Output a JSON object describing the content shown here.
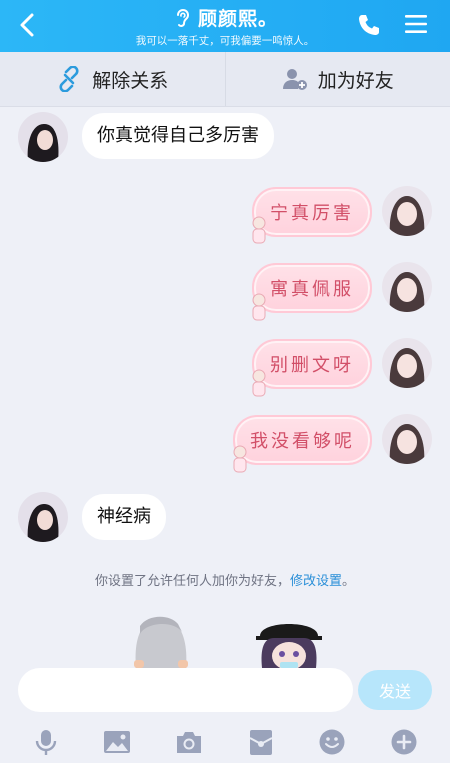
{
  "header": {
    "title": "顾颜熙。",
    "subtitle": "我可以一落千丈，可我偏要一鸣惊人。"
  },
  "actions": {
    "remove_relation": "解除关系",
    "add_friend": "加为好友"
  },
  "messages": [
    {
      "side": "in",
      "text": "你真觉得自己多厉害"
    },
    {
      "side": "out",
      "text": "宁真厉害"
    },
    {
      "side": "out",
      "text": "寓真佩服"
    },
    {
      "side": "out",
      "text": "别删文呀"
    },
    {
      "side": "out",
      "text": "我没看够呢"
    },
    {
      "side": "in",
      "text": "神经病"
    }
  ],
  "notice": {
    "text": "你设置了允许任何人加你为好友，",
    "link": "修改设置",
    "suffix": "。"
  },
  "composer": {
    "placeholder": "",
    "send_label": "发送"
  },
  "colors": {
    "header": "#22aff5",
    "background": "#eef0f7",
    "bubble_out": "#ffd6df",
    "send": "#b7e6fb",
    "icon": "#9aa3bb"
  },
  "toolbar_icons": [
    "mic-icon",
    "image-icon",
    "camera-icon",
    "red-packet-icon",
    "emoji-icon",
    "plus-icon"
  ]
}
